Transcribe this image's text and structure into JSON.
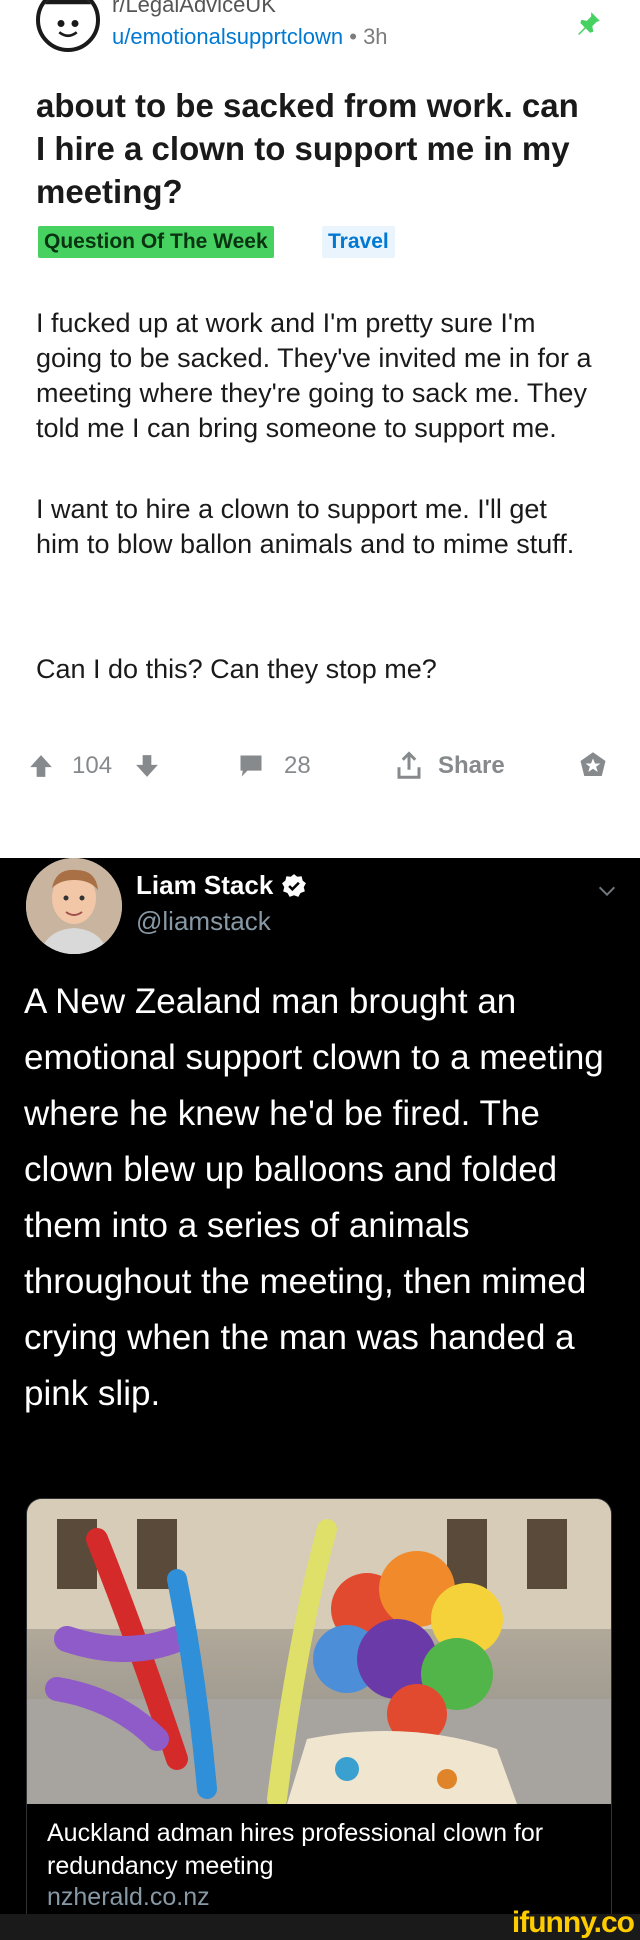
{
  "reddit": {
    "subreddit": "r/LegalAdviceUK",
    "username": "u/emotionalsupprtclown",
    "age": " • 3h",
    "title": "about to be sacked from work. can I hire a clown to support me in my meeting?",
    "flairs": [
      "Question Of The Week",
      "Travel"
    ],
    "body": [
      "I fucked up at work and I'm pretty sure I'm going to be sacked. They've invited me in for a meeting where they're going to sack me. They told me I can bring someone to support me.",
      "I want to hire a clown to support me. I'll get him to blow ballon animals and to mime stuff.",
      "Can I do this? Can they stop me?"
    ],
    "votes": "104",
    "comments": "28",
    "share_label": "Share",
    "colors": {
      "upvote": "#878a8c",
      "link": "#0079d3",
      "flair_green": "#46d160",
      "pin": "#46d160"
    }
  },
  "tweet": {
    "name": "Liam Stack",
    "handle": "@liamstack",
    "text": "A New Zealand man brought an emotional support clown to a meeting where he knew he'd be fired. The clown blew up balloons and folded them into a series of animals throughout the meeting, then mimed crying when the man was handed a pink slip.",
    "card": {
      "title": "Auckland adman hires professional clown for redundancy meeting",
      "domain": "nzherald.co.nz"
    }
  },
  "footer": {
    "watermark": "ifunny.co"
  }
}
